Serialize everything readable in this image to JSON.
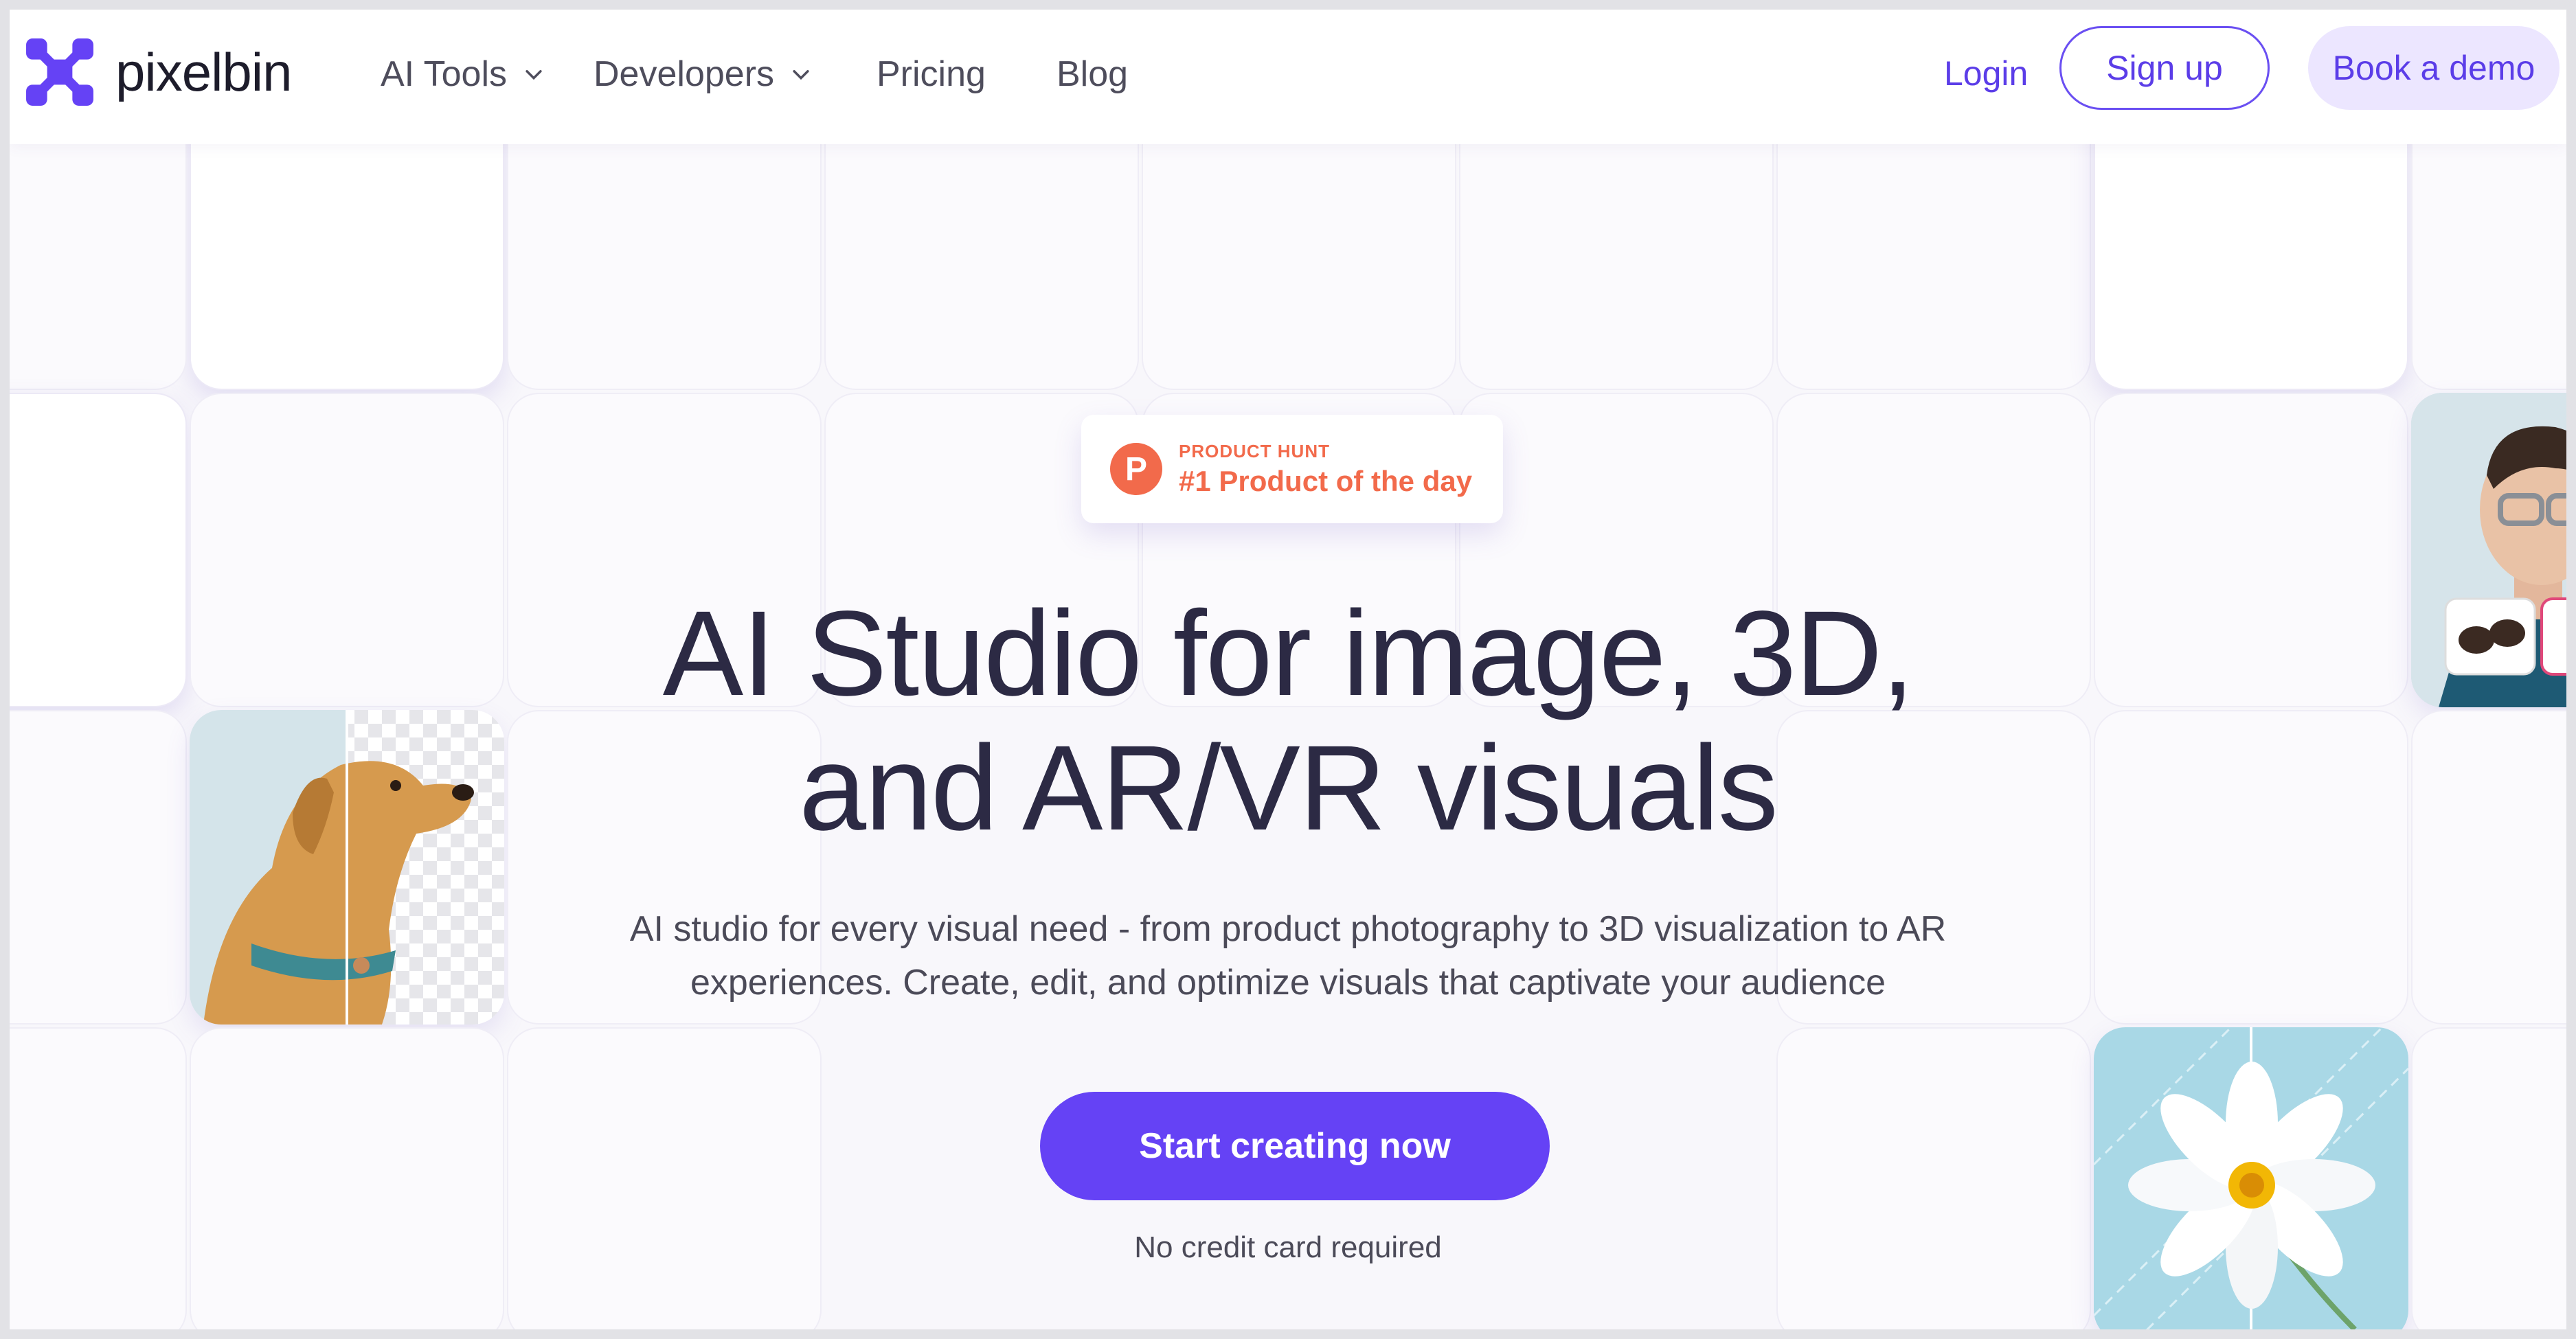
{
  "brand": {
    "name": "pixelbin",
    "accent": "#6542f5"
  },
  "nav": {
    "items": [
      {
        "label": "AI Tools",
        "dropdown": true
      },
      {
        "label": "Developers",
        "dropdown": true
      },
      {
        "label": "Pricing",
        "dropdown": false
      },
      {
        "label": "Blog",
        "dropdown": false
      }
    ],
    "login": "Login",
    "signup": "Sign up",
    "demo": "Book a demo"
  },
  "badge": {
    "icon_letter": "P",
    "kicker": "PRODUCT HUNT",
    "title": "#1 Product of the day"
  },
  "hero": {
    "title_line1": "AI Studio for image, 3D,",
    "title_line2": "and AR/VR visuals",
    "subtitle_line1": "AI studio for every visual need - from product photography to 3D visualization to AR",
    "subtitle_line2": "experiences. Create, edit, and optimize visuals that captivate your audience",
    "cta": "Start creating now",
    "note": "No credit card required"
  },
  "tiles": [
    {
      "name": "dog-background-removal-tile",
      "subject": "golden retriever"
    },
    {
      "name": "man-glasses-tryon-tile",
      "subject": "man with glasses"
    },
    {
      "name": "flower-tile",
      "subject": "white flower"
    }
  ]
}
